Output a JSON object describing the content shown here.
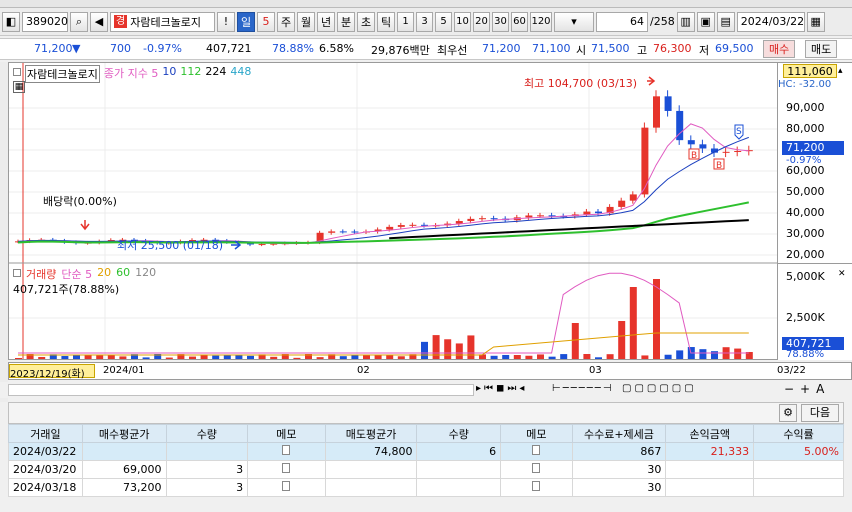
{
  "toolbar": {
    "code": "389020",
    "stock_name": "자람테크놀로지",
    "badge": "경",
    "alert": "!",
    "period_day": "일",
    "period_num": "5",
    "periods": [
      "주",
      "월",
      "년",
      "분",
      "초",
      "틱"
    ],
    "intervals": [
      "1",
      "3",
      "5",
      "10",
      "20",
      "30",
      "60",
      "120"
    ],
    "count": "64",
    "count_total": "/258",
    "date": "2024/03/22"
  },
  "info": {
    "price": "71,200",
    "arrow": "▼",
    "change": "700",
    "change_pct": "-0.97%",
    "volume": "407,721",
    "vol_ratio": "78.88%",
    "turnover": "6.58%",
    "amount": "29,876백만",
    "best_bid_label": "최우선",
    "bid1": "71,200",
    "bid2": "71,100",
    "open_label": "시",
    "open": "71,500",
    "high_label": "고",
    "high": "76,300",
    "low_label": "저",
    "low": "69,500",
    "buy": "매수",
    "sell": "매도"
  },
  "chart": {
    "legend_name": "자람테크놀로지",
    "legend_ma": "종가 지수 5",
    "ma": [
      "10",
      "112",
      "224",
      "448"
    ],
    "high_note": "최고 104,700 (03/13)",
    "low_note": "최저 25,500 (01/18)",
    "dividend_note": "배당락(0.00%)",
    "vol_legend": "거래량",
    "vol_ma": "단순 5",
    "vol_ma_nums": [
      "20",
      "60",
      "120"
    ],
    "vol_text": "407,721주(78.88%)",
    "axis_top_box": "111,060",
    "price_box": "71,200",
    "price_pct": "-0.97%",
    "hc_label": "HC: -32.00",
    "vol_box": "407,721",
    "vol_pct": "78.88%",
    "xlabel_left": "2023/12/19(화)",
    "xlabels": [
      "2024/01",
      "02",
      "03"
    ],
    "xlabel_right": "03/22",
    "y_ticks": [
      "90,000",
      "80,000",
      "70,000",
      "60,000",
      "50,000",
      "40,000",
      "30,000",
      "20,000"
    ],
    "vol_ticks": [
      "5,000K",
      "2,500K"
    ]
  },
  "chart_data": {
    "type": "candlestick",
    "period": "daily",
    "x": [
      "2023/12/19",
      "2024/01",
      "2024/02",
      "2024/03",
      "2024/03/13",
      "2024/03/22"
    ],
    "ylim": [
      20000,
      111060
    ],
    "high_close_points": [
      {
        "date": "2024/03/13",
        "value": 104700
      }
    ],
    "low_point": {
      "date": "2024/01/18",
      "value": 25500
    },
    "last": {
      "date": "2024/03/22",
      "close": 71200,
      "open": 71500,
      "high": 76300,
      "low": 69500,
      "volume": 407721
    }
  },
  "subtool": {
    "next": "다음"
  },
  "table": {
    "headers": [
      "거래일",
      "매수평균가",
      "수량",
      "메모",
      "매도평균가",
      "수량",
      "메모",
      "수수료+제세금",
      "손익금액",
      "수익률"
    ],
    "rows": [
      {
        "date": "2024/03/22",
        "buy_avg": "",
        "buy_qty": "",
        "sell_avg": "74,800",
        "sell_qty": "6",
        "fee": "867",
        "pnl": "21,333",
        "ret": "5.00%"
      },
      {
        "date": "2024/03/20",
        "buy_avg": "69,000",
        "buy_qty": "3",
        "sell_avg": "",
        "sell_qty": "",
        "fee": "30",
        "pnl": "",
        "ret": ""
      },
      {
        "date": "2024/03/18",
        "buy_avg": "73,200",
        "buy_qty": "3",
        "sell_avg": "",
        "sell_qty": "",
        "fee": "30",
        "pnl": "",
        "ret": ""
      }
    ]
  },
  "colors": {
    "up": "#e6342b",
    "down": "#1a4fd6",
    "ma5": "#e05bc1",
    "ma10": "#1a3fbf",
    "ma112": "#2ec02e",
    "ma224": "#000000"
  }
}
